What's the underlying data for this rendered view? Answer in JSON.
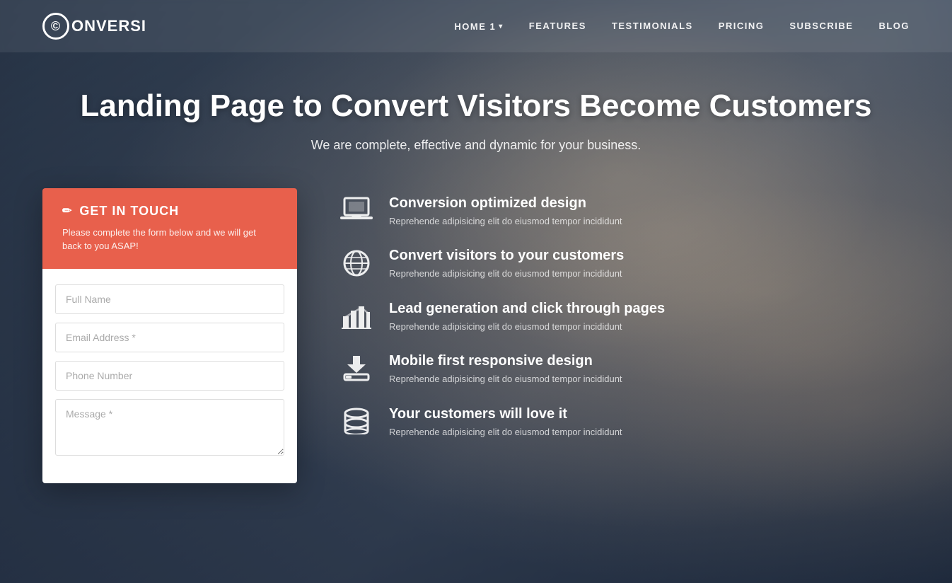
{
  "brand": {
    "name": "ONVERSI",
    "logo_letter": "C"
  },
  "nav": {
    "items": [
      {
        "label": "HOME 1",
        "has_dropdown": true
      },
      {
        "label": "FEATURES",
        "has_dropdown": false
      },
      {
        "label": "TESTIMONIALS",
        "has_dropdown": false
      },
      {
        "label": "PRICING",
        "has_dropdown": false
      },
      {
        "label": "SUBSCRIBE",
        "has_dropdown": false
      },
      {
        "label": "BLOG",
        "has_dropdown": false
      }
    ]
  },
  "hero": {
    "title": "Landing Page to Convert Visitors Become Customers",
    "subtitle": "We are complete, effective and dynamic for your business."
  },
  "form": {
    "header_title": "GET IN TOUCH",
    "header_desc": "Please complete the form below and we will get back to you ASAP!",
    "fields": {
      "full_name_placeholder": "Full Name",
      "email_placeholder": "Email Address *",
      "phone_placeholder": "Phone Number",
      "message_placeholder": "Message *"
    }
  },
  "features": [
    {
      "id": "conversion",
      "icon": "laptop",
      "title": "Conversion optimized design",
      "desc": "Reprehende adipisicing elit do eiusmod tempor incididunt"
    },
    {
      "id": "visitors",
      "icon": "globe",
      "title": "Convert visitors to your customers",
      "desc": "Reprehende adipisicing elit do eiusmod tempor incididunt"
    },
    {
      "id": "leadgen",
      "icon": "chart",
      "title": "Lead generation and click through pages",
      "desc": "Reprehende adipisicing elit do eiusmod tempor incididunt"
    },
    {
      "id": "mobile",
      "icon": "download",
      "title": "Mobile first responsive design",
      "desc": "Reprehende adipisicing elit do eiusmod tempor incididunt"
    },
    {
      "id": "customers",
      "icon": "database",
      "title": "Your customers will love it",
      "desc": "Reprehende adipisicing elit do eiusmod tempor incididunt"
    }
  ],
  "colors": {
    "accent": "#e8604c",
    "nav_bg": "rgba(255,255,255,0.08)"
  }
}
